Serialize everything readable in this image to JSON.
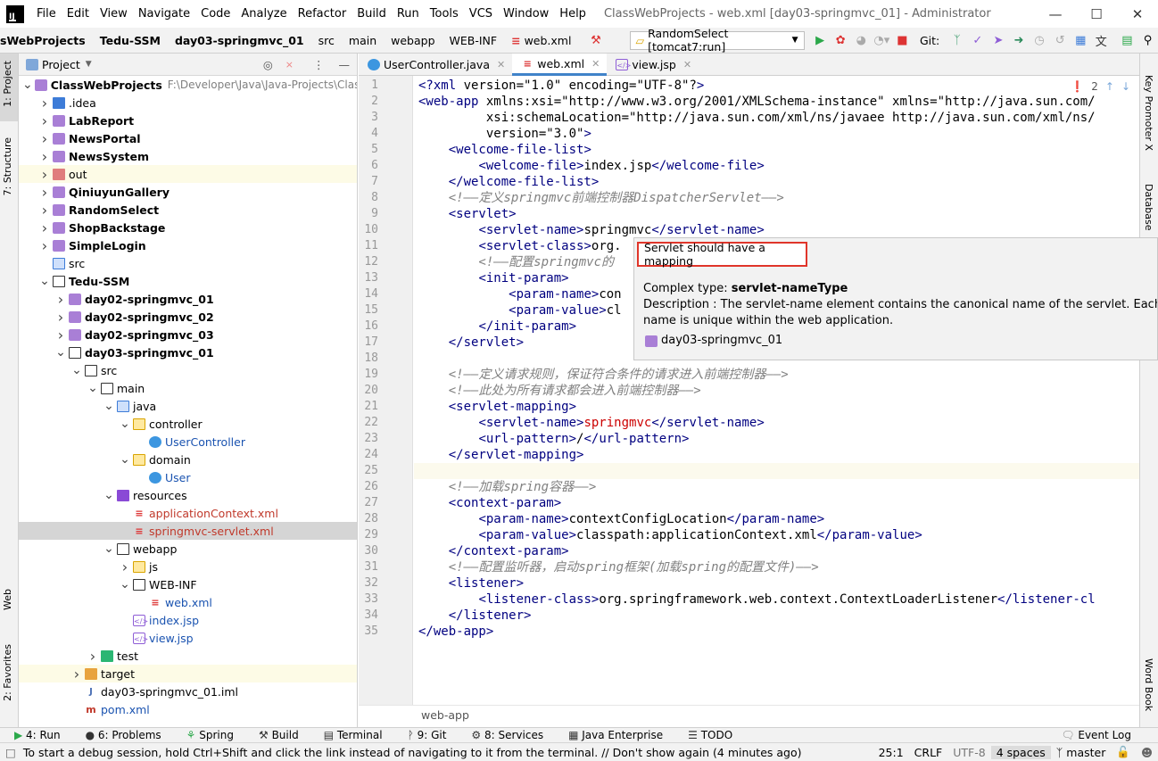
{
  "titlebar": {
    "menu": [
      "File",
      "Edit",
      "View",
      "Navigate",
      "Code",
      "Analyze",
      "Refactor",
      "Build",
      "Run",
      "Tools",
      "VCS",
      "Window",
      "Help"
    ],
    "title": "ClassWebProjects - web.xml [day03-springmvc_01] - Administrator"
  },
  "navbar": {
    "crumbs": [
      "sWebProjects",
      "Tedu-SSM",
      "day03-springmvc_01",
      "src",
      "main",
      "webapp",
      "WEB-INF",
      "web.xml"
    ],
    "run_config": "RandomSelect [tomcat7:run]",
    "git_label": "Git:"
  },
  "left_strip": {
    "project": "1: Project",
    "structure": "7: Structure",
    "web": "Web",
    "favorites": "2: Favorites"
  },
  "right_strip": {
    "key_promoter": "Key Promoter X",
    "database": "Database",
    "word_book": "Word Book"
  },
  "project_panel": {
    "title": "Project",
    "tree": [
      {
        "label": "ClassWebProjects",
        "extra": "F:\\Developer\\Java\\Java-Projects\\Class\\",
        "indent": 0,
        "arrow": "open",
        "icon": "mod",
        "bold": true
      },
      {
        "label": ".idea",
        "indent": 1,
        "arrow": "closed",
        "icon": "idea"
      },
      {
        "label": "LabReport",
        "indent": 1,
        "arrow": "closed",
        "icon": "mod",
        "bold": true
      },
      {
        "label": "NewsPortal",
        "indent": 1,
        "arrow": "closed",
        "icon": "mod",
        "bold": true
      },
      {
        "label": "NewsSystem",
        "indent": 1,
        "arrow": "closed",
        "icon": "mod",
        "bold": true
      },
      {
        "label": "out",
        "indent": 1,
        "arrow": "closed",
        "icon": "out",
        "excluded": true
      },
      {
        "label": "QiniuyunGallery",
        "indent": 1,
        "arrow": "closed",
        "icon": "mod",
        "bold": true
      },
      {
        "label": "RandomSelect",
        "indent": 1,
        "arrow": "closed",
        "icon": "mod",
        "bold": true
      },
      {
        "label": "ShopBackstage",
        "indent": 1,
        "arrow": "closed",
        "icon": "mod",
        "bold": true
      },
      {
        "label": "SimpleLogin",
        "indent": 1,
        "arrow": "closed",
        "icon": "mod",
        "bold": true
      },
      {
        "label": "src",
        "indent": 1,
        "arrow": "none",
        "icon": "src"
      },
      {
        "label": "Tedu-SSM",
        "indent": 1,
        "arrow": "open",
        "icon": "fold",
        "bold": true
      },
      {
        "label": "day02-springmvc_01",
        "indent": 2,
        "arrow": "closed",
        "icon": "mod",
        "bold": true
      },
      {
        "label": "day02-springmvc_02",
        "indent": 2,
        "arrow": "closed",
        "icon": "mod",
        "bold": true
      },
      {
        "label": "day02-springmvc_03",
        "indent": 2,
        "arrow": "closed",
        "icon": "mod",
        "bold": true
      },
      {
        "label": "day03-springmvc_01",
        "indent": 2,
        "arrow": "open",
        "icon": "fold",
        "bold": true
      },
      {
        "label": "src",
        "indent": 3,
        "arrow": "open",
        "icon": "fold"
      },
      {
        "label": "main",
        "indent": 4,
        "arrow": "open",
        "icon": "fold"
      },
      {
        "label": "java",
        "indent": 5,
        "arrow": "open",
        "icon": "src"
      },
      {
        "label": "controller",
        "indent": 6,
        "arrow": "open",
        "icon": "pkg"
      },
      {
        "label": "UserController",
        "indent": 7,
        "arrow": "none",
        "icon": "cls",
        "color": "blue"
      },
      {
        "label": "domain",
        "indent": 6,
        "arrow": "open",
        "icon": "pkg"
      },
      {
        "label": "User",
        "indent": 7,
        "arrow": "none",
        "icon": "cls",
        "color": "blue"
      },
      {
        "label": "resources",
        "indent": 5,
        "arrow": "open",
        "icon": "res"
      },
      {
        "label": "applicationContext.xml",
        "indent": 6,
        "arrow": "none",
        "icon": "xml",
        "color": "red"
      },
      {
        "label": "springmvc-servlet.xml",
        "indent": 6,
        "arrow": "none",
        "icon": "xml",
        "color": "red",
        "selected": true
      },
      {
        "label": "webapp",
        "indent": 5,
        "arrow": "open",
        "icon": "fold"
      },
      {
        "label": "js",
        "indent": 6,
        "arrow": "closed",
        "icon": "pkg"
      },
      {
        "label": "WEB-INF",
        "indent": 6,
        "arrow": "open",
        "icon": "fold"
      },
      {
        "label": "web.xml",
        "indent": 7,
        "arrow": "none",
        "icon": "xml",
        "color": "blue"
      },
      {
        "label": "index.jsp",
        "indent": 6,
        "arrow": "none",
        "icon": "jsp",
        "color": "blue"
      },
      {
        "label": "view.jsp",
        "indent": 6,
        "arrow": "none",
        "icon": "jsp",
        "color": "blue"
      },
      {
        "label": "test",
        "indent": 4,
        "arrow": "closed",
        "icon": "test"
      },
      {
        "label": "target",
        "indent": 3,
        "arrow": "closed",
        "icon": "tgt",
        "excluded": true
      },
      {
        "label": "day03-springmvc_01.iml",
        "indent": 3,
        "arrow": "none",
        "icon": "iml"
      },
      {
        "label": "pom.xml",
        "indent": 3,
        "arrow": "none",
        "icon": "mvn",
        "color": "blue"
      }
    ]
  },
  "tabs": [
    {
      "label": "UserController.java",
      "icon": "cls",
      "active": false
    },
    {
      "label": "web.xml",
      "icon": "xml",
      "active": true
    },
    {
      "label": "view.jsp",
      "icon": "jsp",
      "active": false
    }
  ],
  "editor": {
    "problem_count": "2",
    "lines": [
      "<?xml version=\"1.0\" encoding=\"UTF-8\"?>",
      "<web-app xmlns:xsi=\"http://www.w3.org/2001/XMLSchema-instance\" xmlns=\"http://java.sun.com/",
      "         xsi:schemaLocation=\"http://java.sun.com/xml/ns/javaee http://java.sun.com/xml/ns/",
      "         version=\"3.0\">",
      "    <welcome-file-list>",
      "        <welcome-file>index.jsp</welcome-file>",
      "    </welcome-file-list>",
      "    <!——定义springmvc前端控制器DispatcherServlet——>",
      "    <servlet>",
      "        <servlet-name>springmvc</servlet-name>",
      "        <servlet-class>org.",
      "        <!——配置springmvc的",
      "        <init-param>",
      "            <param-name>con",
      "            <param-value>cl",
      "        </init-param>",
      "    </servlet>",
      "",
      "    <!——定义请求规则，保证符合条件的请求进入前端控制器——>",
      "    <!——此处为所有请求都会进入前端控制器——>",
      "    <servlet-mapping>",
      "        <servlet-name>springmvc</servlet-name>",
      "        <url-pattern>/</url-pattern>",
      "    </servlet-mapping>",
      "",
      "    <!——加载spring容器——>",
      "    <context-param>",
      "        <param-name>contextConfigLocation</param-name>",
      "        <param-value>classpath:applicationContext.xml</param-value>",
      "    </context-param>",
      "    <!——配置监听器，启动spring框架(加载spring的配置文件)——>",
      "    <listener>",
      "        <listener-class>org.springframework.web.context.ContextLoaderListener</listener-cl",
      "    </listener>",
      "</web-app>"
    ],
    "breadcrumb": "web-app"
  },
  "tooltip": {
    "error": "Servlet should have a mapping",
    "complex_type_label": "Complex type: ",
    "complex_type": "servlet-nameType",
    "description": "Description : The servlet-name element contains the canonical name of the servlet. Each servle",
    "description2": "name is unique within the web application.",
    "module": "day03-springmvc_01"
  },
  "toolwindows": [
    {
      "label": "4: Run",
      "icon": "run-icon"
    },
    {
      "label": "6: Problems",
      "icon": "problems-icon"
    },
    {
      "label": "Spring",
      "icon": "spring-icon"
    },
    {
      "label": "Build",
      "icon": "build-icon"
    },
    {
      "label": "Terminal",
      "icon": "terminal-icon"
    },
    {
      "label": "9: Git",
      "icon": "git-icon"
    },
    {
      "label": "8: Services",
      "icon": "services-icon"
    },
    {
      "label": "Java Enterprise",
      "icon": "java-enterprise-icon"
    },
    {
      "label": "TODO",
      "icon": "todo-icon"
    }
  ],
  "event_log": "Event Log",
  "statusbar": {
    "message": "To start a debug session, hold Ctrl+Shift and click the link instead of navigating to it from the terminal. // Don't show again (4 minutes ago)",
    "position": "25:1",
    "line_sep": "CRLF",
    "encoding": "UTF-8",
    "indent": "4 spaces",
    "branch": "master"
  }
}
